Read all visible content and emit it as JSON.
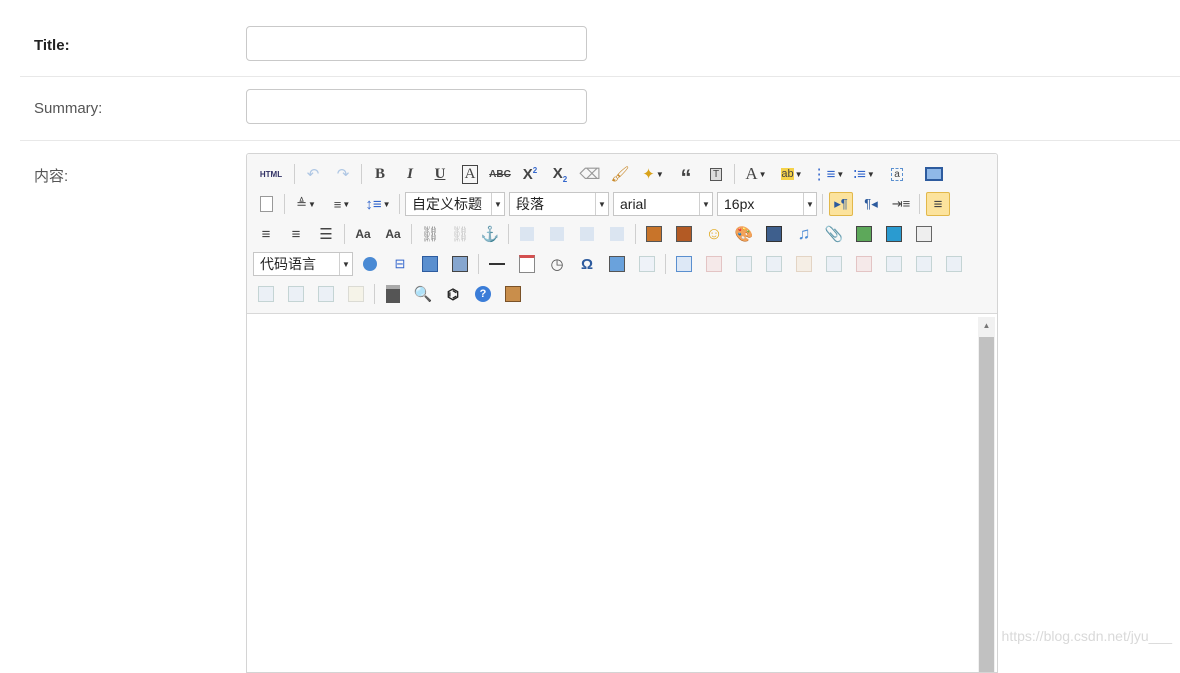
{
  "form": {
    "title_label": "Title:",
    "summary_label": "Summary:",
    "content_label": "内容:",
    "title_value": "",
    "summary_value": ""
  },
  "editor": {
    "toolbar": {
      "html_label": "HTML",
      "custom_heading": "自定义标题",
      "paragraph": "段落",
      "font_family": "arial",
      "font_size": "16px",
      "code_language": "代码语言"
    },
    "content": ""
  },
  "watermark": "https://blog.csdn.net/jyu___"
}
